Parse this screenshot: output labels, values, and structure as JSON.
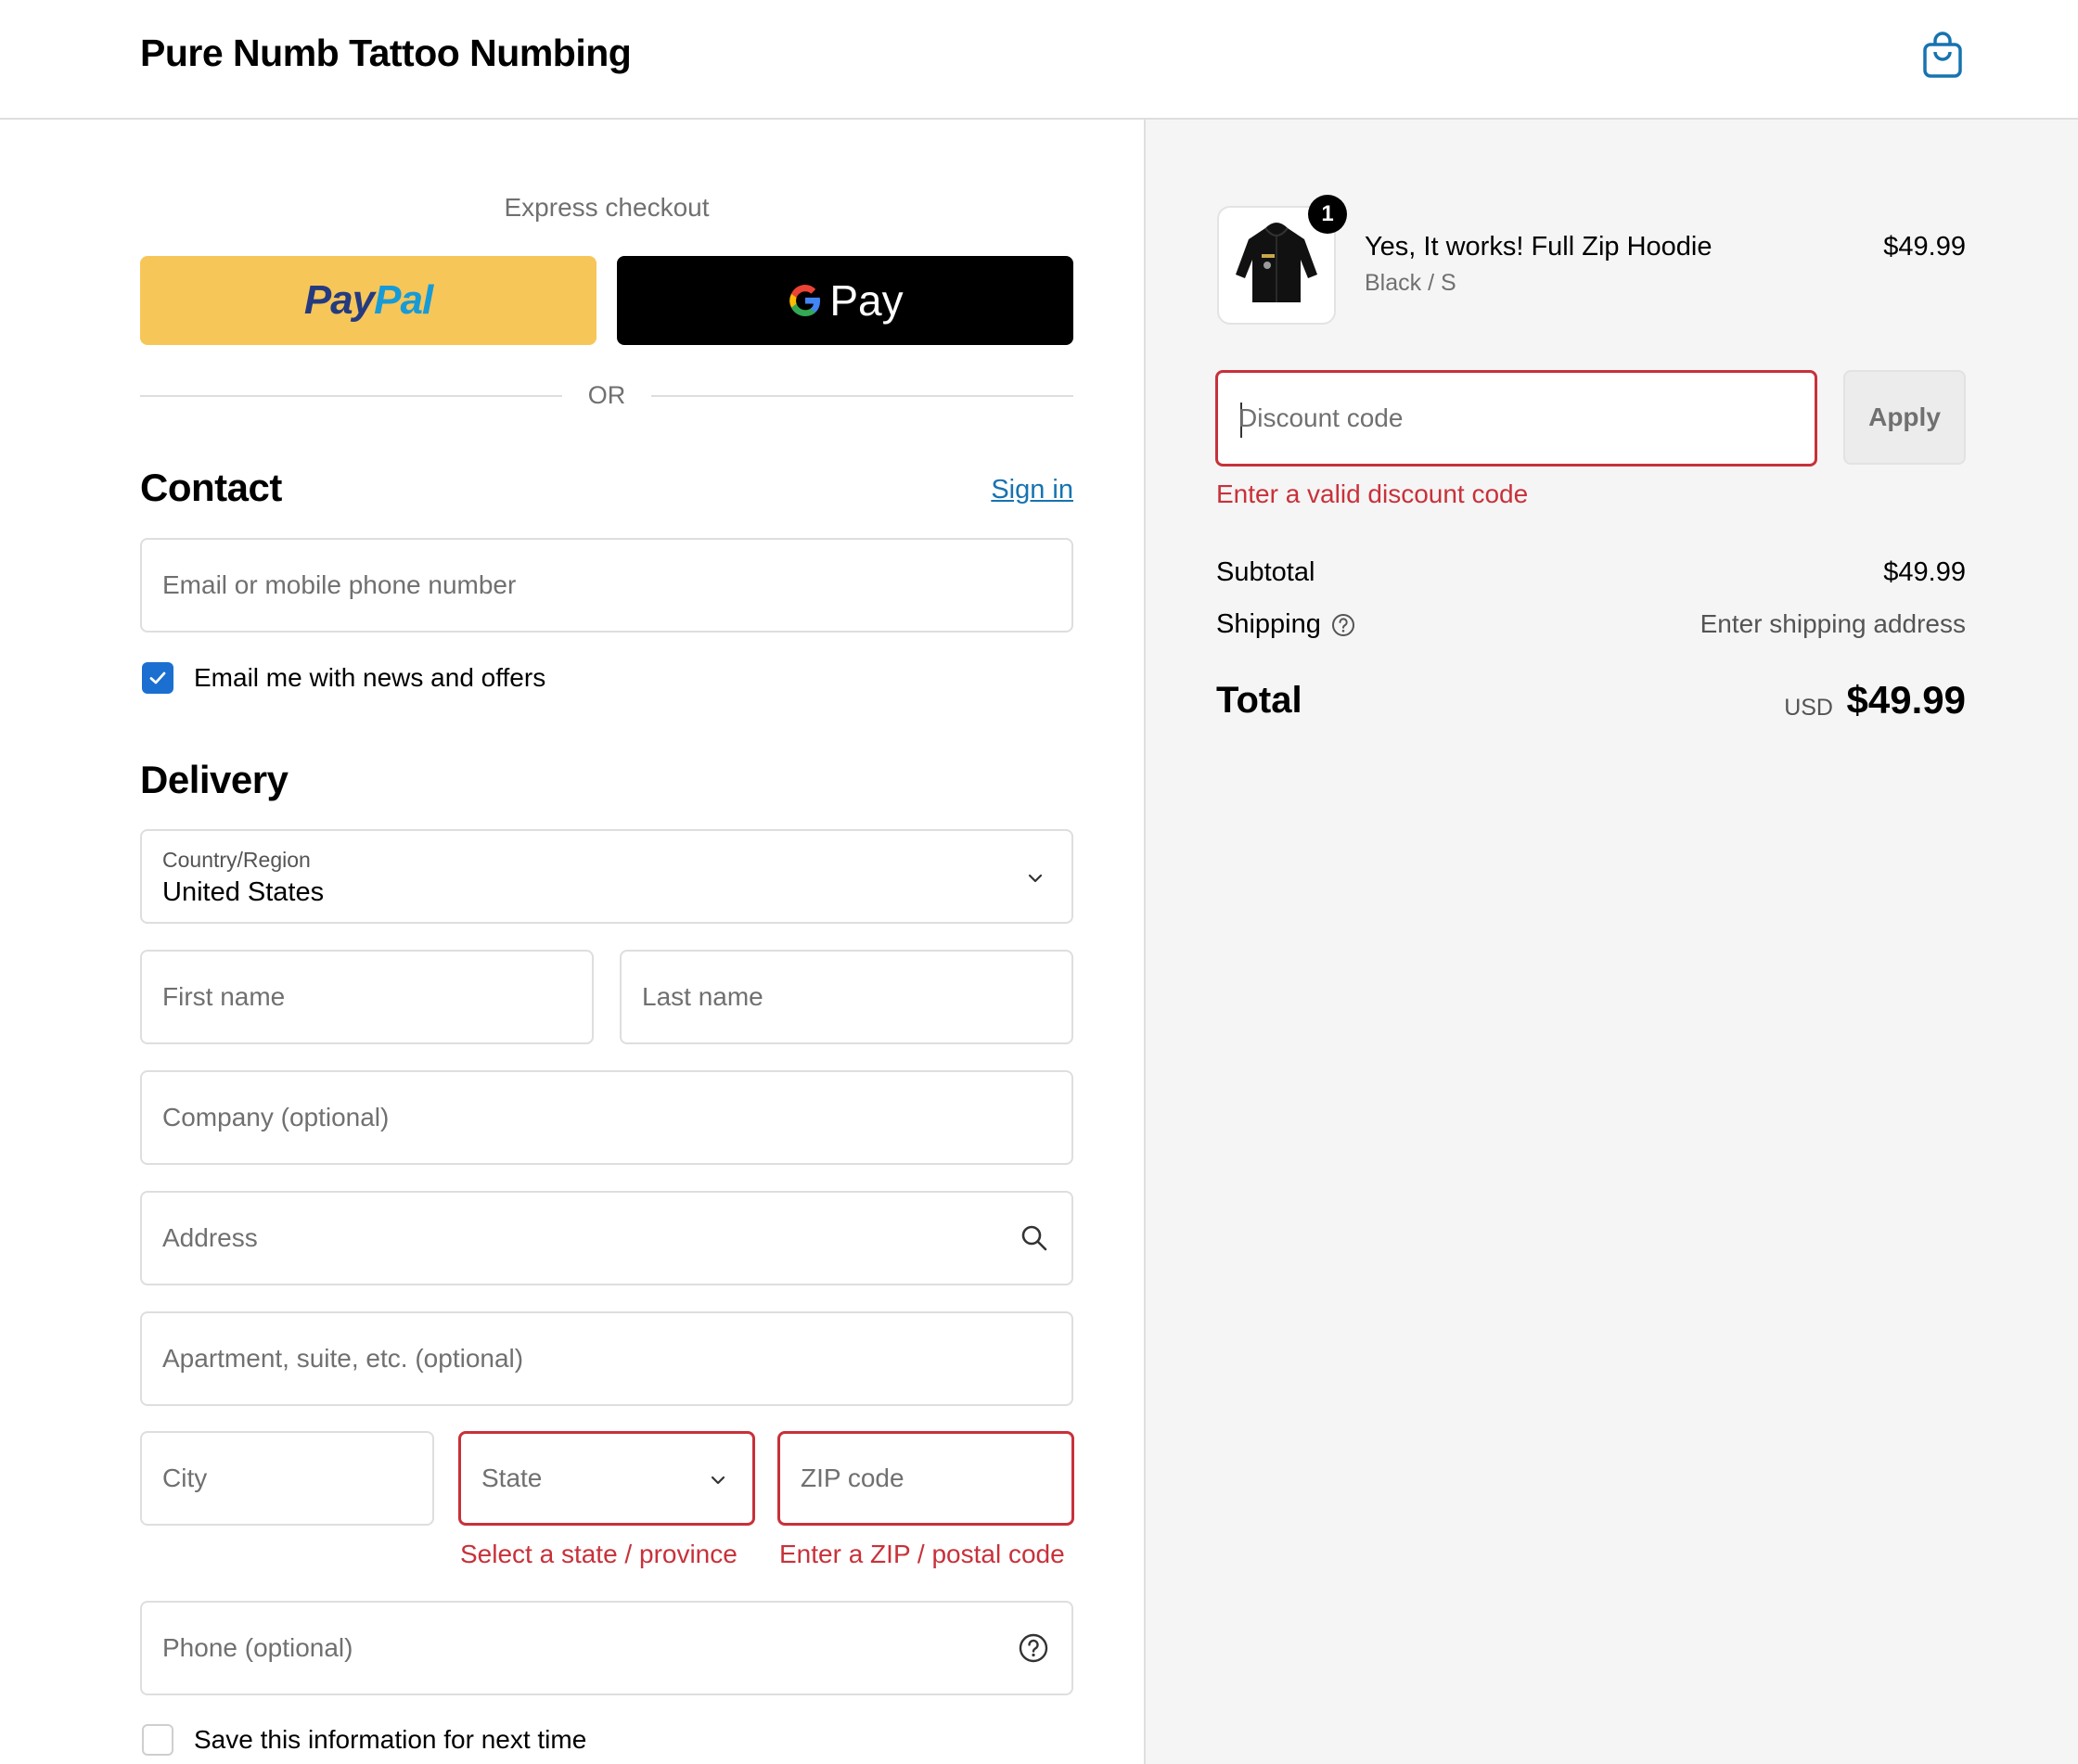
{
  "header": {
    "store_name": "Pure Numb Tattoo Numbing",
    "cart_icon": "shopping-bag-icon"
  },
  "express": {
    "title": "Express checkout",
    "paypal_label_1": "Pay",
    "paypal_label_2": "Pal",
    "gpay_label": "Pay",
    "or_label": "OR"
  },
  "contact": {
    "heading": "Contact",
    "sign_in": "Sign in",
    "email_placeholder": "Email or mobile phone number",
    "news_checkbox_label": "Email me with news and offers",
    "news_checked": true
  },
  "delivery": {
    "heading": "Delivery",
    "country_label": "Country/Region",
    "country_value": "United States",
    "first_name_placeholder": "First name",
    "last_name_placeholder": "Last name",
    "company_placeholder": "Company (optional)",
    "address_placeholder": "Address",
    "apartment_placeholder": "Apartment, suite, etc. (optional)",
    "city_placeholder": "City",
    "state_placeholder": "State",
    "state_error": "Select a state / province",
    "zip_placeholder": "ZIP code",
    "zip_error": "Enter a ZIP / postal code",
    "phone_placeholder": "Phone (optional)",
    "save_checkbox_label": "Save this information for next time",
    "save_checked": false
  },
  "summary": {
    "item": {
      "quantity": "1",
      "name": "Yes, It works! Full Zip Hoodie",
      "variant": "Black / S",
      "price": "$49.99"
    },
    "discount_placeholder": "Discount code",
    "apply_label": "Apply",
    "discount_error": "Enter a valid discount code",
    "subtotal_label": "Subtotal",
    "subtotal_value": "$49.99",
    "shipping_label": "Shipping",
    "shipping_value": "Enter shipping address",
    "total_label": "Total",
    "total_currency": "USD",
    "total_value": "$49.99"
  },
  "colors": {
    "paypal_yellow": "#f7c659",
    "error_red": "#c8313a",
    "link_blue": "#1773b0",
    "checkbox_blue": "#1a6fd0"
  }
}
